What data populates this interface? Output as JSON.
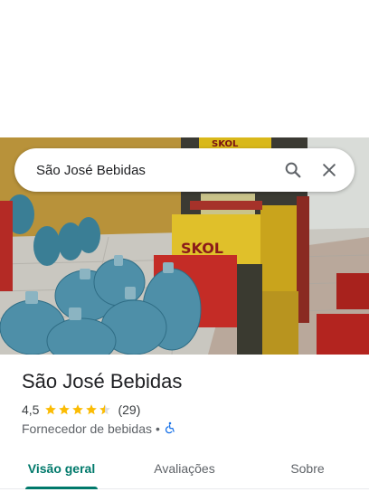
{
  "search": {
    "query": "São José Bebidas",
    "search_icon": "search-icon",
    "close_icon": "close-icon"
  },
  "photo": {
    "crate_label_1": "SKOL",
    "crate_label_2": "SKOL"
  },
  "place": {
    "name": "São José Bebidas",
    "rating": "4,5",
    "stars": 4.5,
    "review_count": "(29)",
    "category": "Fornecedor de bebidas",
    "separator": "•",
    "accessibility_icon": "wheelchair-icon"
  },
  "tabs": [
    {
      "label": "Visão geral",
      "active": true
    },
    {
      "label": "Avaliações",
      "active": false
    },
    {
      "label": "Sobre",
      "active": false
    }
  ],
  "colors": {
    "accent": "#00796b",
    "star": "#fbbc04",
    "accessibility": "#1a73e8"
  }
}
